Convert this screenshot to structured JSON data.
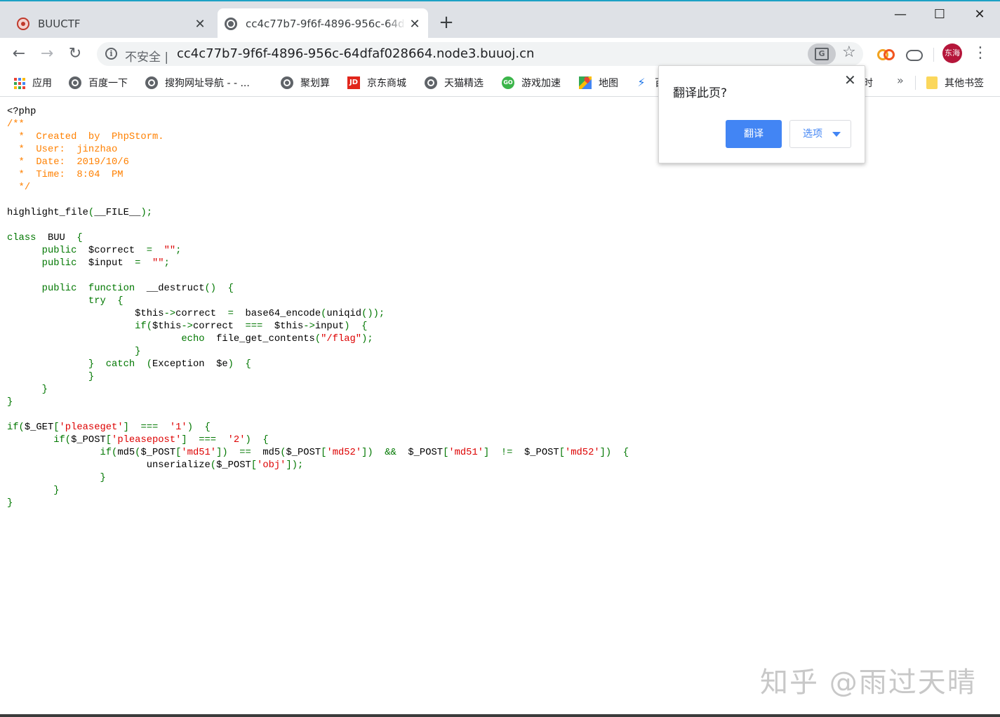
{
  "tabs": [
    {
      "title": "BUUCTF",
      "close": "✕"
    },
    {
      "title": "cc4c77b7-9f6f-4896-956c-64dfaf028664",
      "close": "✕"
    }
  ],
  "window": {
    "new_tab": "+",
    "minimize": "—",
    "maximize": "☐",
    "close": "✕"
  },
  "toolbar": {
    "back": "←",
    "forward": "→",
    "reload": "↻",
    "insecure_label": "不安全 |",
    "url": "cc4c77b7-9f6f-4896-956c-64dfaf028664.node3.buuoj.cn",
    "star": "☆",
    "avatar_text": "东海",
    "menu": "⋮"
  },
  "bookmarks": [
    {
      "label": "应用",
      "icon": "apps-grid-icon"
    },
    {
      "label": "百度一下",
      "icon": "globe-icon"
    },
    {
      "label": "搜狗网址导航 - - ...",
      "icon": "globe-icon"
    },
    {
      "label": "聚划算",
      "icon": "globe-icon"
    },
    {
      "label": "京东商城",
      "icon": "jd-icon"
    },
    {
      "label": "天猫精选",
      "icon": "globe-icon"
    },
    {
      "label": "游戏加速",
      "icon": "game-icon"
    },
    {
      "label": "地图",
      "icon": "map-icon"
    },
    {
      "label": "百",
      "icon": "blue-icon"
    },
    {
      "label": "时",
      "icon": ""
    }
  ],
  "bookmarks_more": "»",
  "other_bookmarks": "其他书签",
  "translate_popup": {
    "title": "翻译此页?",
    "close": "✕",
    "translate_button": "翻译",
    "options_button": "选项"
  },
  "code_lines": [
    [
      {
        "t": "<?php",
        "c": "def"
      }
    ],
    [
      {
        "t": "/**",
        "c": "cmt"
      }
    ],
    [
      {
        "t": "  *  Created  by  PhpStorm.",
        "c": "cmt"
      }
    ],
    [
      {
        "t": "  *  User:  jinzhao",
        "c": "cmt"
      }
    ],
    [
      {
        "t": "  *  Date:  2019/10/6",
        "c": "cmt"
      }
    ],
    [
      {
        "t": "  *  Time:  8:04  PM",
        "c": "cmt"
      }
    ],
    [
      {
        "t": "  */",
        "c": "cmt"
      }
    ],
    [
      {
        "t": "",
        "c": "def"
      }
    ],
    [
      {
        "t": "highlight_file",
        "c": "def"
      },
      {
        "t": "(",
        "c": "kw"
      },
      {
        "t": "__FILE__",
        "c": "def"
      },
      {
        "t": ");",
        "c": "kw"
      }
    ],
    [
      {
        "t": "",
        "c": "def"
      }
    ],
    [
      {
        "t": "class  ",
        "c": "kw"
      },
      {
        "t": "BUU  ",
        "c": "def"
      },
      {
        "t": "{",
        "c": "kw"
      }
    ],
    [
      {
        "t": "      public  ",
        "c": "kw"
      },
      {
        "t": "$correct  ",
        "c": "def"
      },
      {
        "t": "=  ",
        "c": "kw"
      },
      {
        "t": "\"\"",
        "c": "str"
      },
      {
        "t": ";",
        "c": "kw"
      }
    ],
    [
      {
        "t": "      public  ",
        "c": "kw"
      },
      {
        "t": "$input  ",
        "c": "def"
      },
      {
        "t": "=  ",
        "c": "kw"
      },
      {
        "t": "\"\"",
        "c": "str"
      },
      {
        "t": ";",
        "c": "kw"
      }
    ],
    [
      {
        "t": "",
        "c": "def"
      }
    ],
    [
      {
        "t": "      public  function  ",
        "c": "kw"
      },
      {
        "t": "__destruct",
        "c": "def"
      },
      {
        "t": "()  {",
        "c": "kw"
      }
    ],
    [
      {
        "t": "              try  {",
        "c": "kw"
      }
    ],
    [
      {
        "t": "                      ",
        "c": "def"
      },
      {
        "t": "$this",
        "c": "def"
      },
      {
        "t": "->",
        "c": "kw"
      },
      {
        "t": "correct  ",
        "c": "def"
      },
      {
        "t": "=  ",
        "c": "kw"
      },
      {
        "t": "base64_encode",
        "c": "def"
      },
      {
        "t": "(",
        "c": "kw"
      },
      {
        "t": "uniqid",
        "c": "def"
      },
      {
        "t": "());",
        "c": "kw"
      }
    ],
    [
      {
        "t": "                      if(",
        "c": "kw"
      },
      {
        "t": "$this",
        "c": "def"
      },
      {
        "t": "->",
        "c": "kw"
      },
      {
        "t": "correct  ",
        "c": "def"
      },
      {
        "t": "===  ",
        "c": "kw"
      },
      {
        "t": "$this",
        "c": "def"
      },
      {
        "t": "->",
        "c": "kw"
      },
      {
        "t": "input",
        "c": "def"
      },
      {
        "t": ")  {",
        "c": "kw"
      }
    ],
    [
      {
        "t": "                              echo  ",
        "c": "kw"
      },
      {
        "t": "file_get_contents",
        "c": "def"
      },
      {
        "t": "(",
        "c": "kw"
      },
      {
        "t": "\"/flag\"",
        "c": "str"
      },
      {
        "t": ");",
        "c": "kw"
      }
    ],
    [
      {
        "t": "                      }",
        "c": "kw"
      }
    ],
    [
      {
        "t": "              }  catch  (",
        "c": "kw"
      },
      {
        "t": "Exception  $e",
        "c": "def"
      },
      {
        "t": ")  {",
        "c": "kw"
      }
    ],
    [
      {
        "t": "              }",
        "c": "kw"
      }
    ],
    [
      {
        "t": "      }",
        "c": "kw"
      }
    ],
    [
      {
        "t": "}",
        "c": "kw"
      }
    ],
    [
      {
        "t": "",
        "c": "def"
      }
    ],
    [
      {
        "t": "if(",
        "c": "kw"
      },
      {
        "t": "$_GET",
        "c": "def"
      },
      {
        "t": "[",
        "c": "kw"
      },
      {
        "t": "'pleaseget'",
        "c": "str"
      },
      {
        "t": "]  ===  ",
        "c": "kw"
      },
      {
        "t": "'1'",
        "c": "str"
      },
      {
        "t": ")  {",
        "c": "kw"
      }
    ],
    [
      {
        "t": "        if(",
        "c": "kw"
      },
      {
        "t": "$_POST",
        "c": "def"
      },
      {
        "t": "[",
        "c": "kw"
      },
      {
        "t": "'pleasepost'",
        "c": "str"
      },
      {
        "t": "]  ===  ",
        "c": "kw"
      },
      {
        "t": "'2'",
        "c": "str"
      },
      {
        "t": ")  {",
        "c": "kw"
      }
    ],
    [
      {
        "t": "                if(",
        "c": "kw"
      },
      {
        "t": "md5",
        "c": "def"
      },
      {
        "t": "(",
        "c": "kw"
      },
      {
        "t": "$_POST",
        "c": "def"
      },
      {
        "t": "[",
        "c": "kw"
      },
      {
        "t": "'md51'",
        "c": "str"
      },
      {
        "t": "])  ==  ",
        "c": "kw"
      },
      {
        "t": "md5",
        "c": "def"
      },
      {
        "t": "(",
        "c": "kw"
      },
      {
        "t": "$_POST",
        "c": "def"
      },
      {
        "t": "[",
        "c": "kw"
      },
      {
        "t": "'md52'",
        "c": "str"
      },
      {
        "t": "])  &&  ",
        "c": "kw"
      },
      {
        "t": "$_POST",
        "c": "def"
      },
      {
        "t": "[",
        "c": "kw"
      },
      {
        "t": "'md51'",
        "c": "str"
      },
      {
        "t": "]  !=  ",
        "c": "kw"
      },
      {
        "t": "$_POST",
        "c": "def"
      },
      {
        "t": "[",
        "c": "kw"
      },
      {
        "t": "'md52'",
        "c": "str"
      },
      {
        "t": "])  {",
        "c": "kw"
      }
    ],
    [
      {
        "t": "                        ",
        "c": "def"
      },
      {
        "t": "unserialize",
        "c": "def"
      },
      {
        "t": "(",
        "c": "kw"
      },
      {
        "t": "$_POST",
        "c": "def"
      },
      {
        "t": "[",
        "c": "kw"
      },
      {
        "t": "'obj'",
        "c": "str"
      },
      {
        "t": "]);",
        "c": "kw"
      }
    ],
    [
      {
        "t": "                }",
        "c": "kw"
      }
    ],
    [
      {
        "t": "        }",
        "c": "kw"
      }
    ],
    [
      {
        "t": "}",
        "c": "kw"
      }
    ]
  ],
  "watermark": "知乎 @雨过天晴"
}
